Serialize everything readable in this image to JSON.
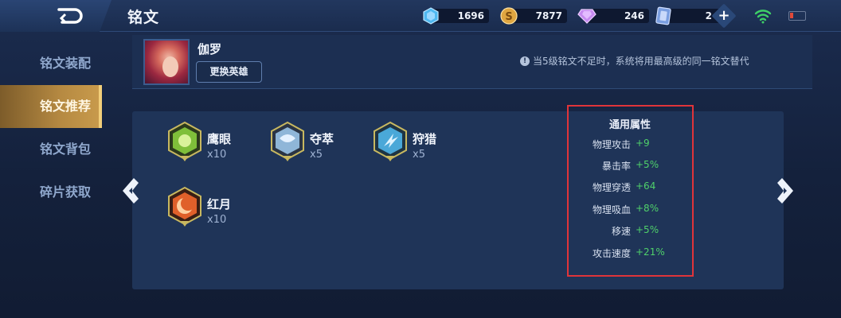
{
  "header": {
    "title": "铭文",
    "resources": [
      {
        "name": "diamond-icon",
        "value": "1696",
        "color": "#4fb8f0"
      },
      {
        "name": "gold-coin-icon",
        "value": "7877",
        "color": "#e0a640"
      },
      {
        "name": "gem-icon",
        "value": "246",
        "color": "#c68af0"
      },
      {
        "name": "ticket-icon",
        "value": "2",
        "color": "#7a9ee0"
      }
    ]
  },
  "sidebar": {
    "items": [
      {
        "label": "铭文装配"
      },
      {
        "label": "铭文推荐"
      },
      {
        "label": "铭文背包"
      },
      {
        "label": "碎片获取"
      }
    ],
    "active_index": 1
  },
  "hero": {
    "name": "伽罗",
    "change_button": "更换英雄",
    "notice": "当5级铭文不足时，系统将用最高级的同一铭文替代"
  },
  "runes": [
    {
      "name": "鹰眼",
      "count": "x10",
      "icon": "hawk-eye-rune-icon",
      "color": "#7fbf3a"
    },
    {
      "name": "夺萃",
      "count": "x5",
      "icon": "snatch-rune-icon",
      "color": "#8fb6d8"
    },
    {
      "name": "狩猎",
      "count": "x5",
      "icon": "hunt-rune-icon",
      "color": "#4aa8d8"
    },
    {
      "name": "红月",
      "count": "x10",
      "icon": "red-moon-rune-icon",
      "color": "#e0602a"
    }
  ],
  "attributes": {
    "title": "通用属性",
    "rows": [
      {
        "name": "物理攻击",
        "value": "+9"
      },
      {
        "name": "暴击率",
        "value": "+5%"
      },
      {
        "name": "物理穿透",
        "value": "+64"
      },
      {
        "name": "物理吸血",
        "value": "+8%"
      },
      {
        "name": "移速",
        "value": "+5%"
      },
      {
        "name": "攻击速度",
        "value": "+21%"
      }
    ]
  },
  "colors": {
    "accent_gold": "#c99b4c",
    "highlight_red": "#e0343a",
    "stat_green": "#4fd06a"
  }
}
